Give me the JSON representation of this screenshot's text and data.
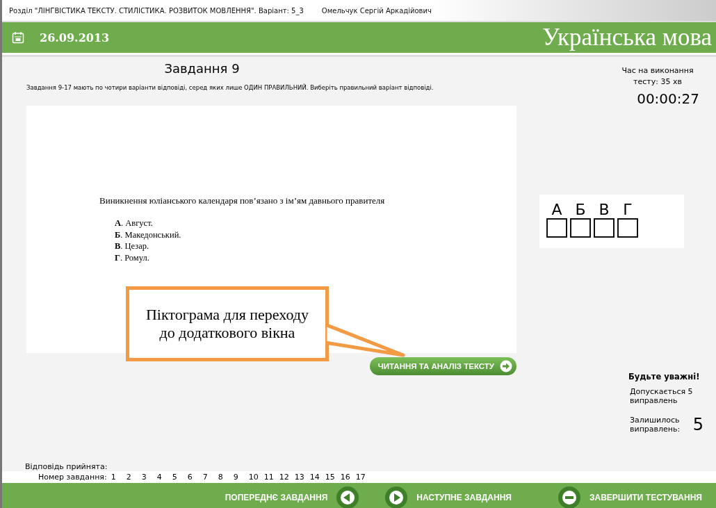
{
  "window": {
    "title": "Розділ \"ЛІНГВІСТИКА ТЕКСТУ. СТИЛІСТИКА. РОЗВИТОК МОВЛЕННЯ\". Варіант: 5_3",
    "user": "Омельчук Сергій Аркадійович"
  },
  "header": {
    "date": "26.09.2013",
    "subject": "Українська мова"
  },
  "task": {
    "title": "Завдання 9",
    "instruction": "Завдання 9-17 мають по чотири варіанти відповіді, серед яких лише ОДИН ПРАВИЛЬНИЙ. Виберіть правильний варіант відповіді.",
    "question": "Виникнення юліанського календаря пов’язано з ім’ям давнього правителя",
    "options": [
      "**А**. Август.",
      "**Б**. Македонський.",
      "**В**. Цезар.",
      "**Г**. Ромул."
    ],
    "text_button": "ЧИТАННЯ ТА АНАЛІЗ ТЕКСТУ"
  },
  "callout": "Піктограма для переходу до додаткового вікна",
  "timer": {
    "label": "Час на виконання тесту: 35 хв",
    "value": "00:00:27"
  },
  "answers": [
    {
      "letter": "А",
      "checked": false
    },
    {
      "letter": "Б",
      "checked": false
    },
    {
      "letter": "В",
      "checked": false
    },
    {
      "letter": "Г",
      "checked": false
    }
  ],
  "warning": {
    "title": "Будьте уважні!",
    "allowed": "Допускається 5 виправлень",
    "remaining_label": "Залишилось виправлень:",
    "remaining": "5"
  },
  "status": "Відповідь прийнята:",
  "task_numbers": {
    "label": "Номер завдання:",
    "items": [
      "1",
      "2",
      "3",
      "4",
      "5",
      "6",
      "7",
      "8",
      "9",
      "10",
      "11",
      "12",
      "13",
      "14",
      "15",
      "16",
      "17"
    ]
  },
  "footer": {
    "prev": "ПОПЕРЕДНЄ ЗАВДАННЯ",
    "next": "НАСТУПНЕ ЗАВДАННЯ",
    "finish": "ЗАВЕРШИТИ ТЕСТУВАННЯ"
  }
}
